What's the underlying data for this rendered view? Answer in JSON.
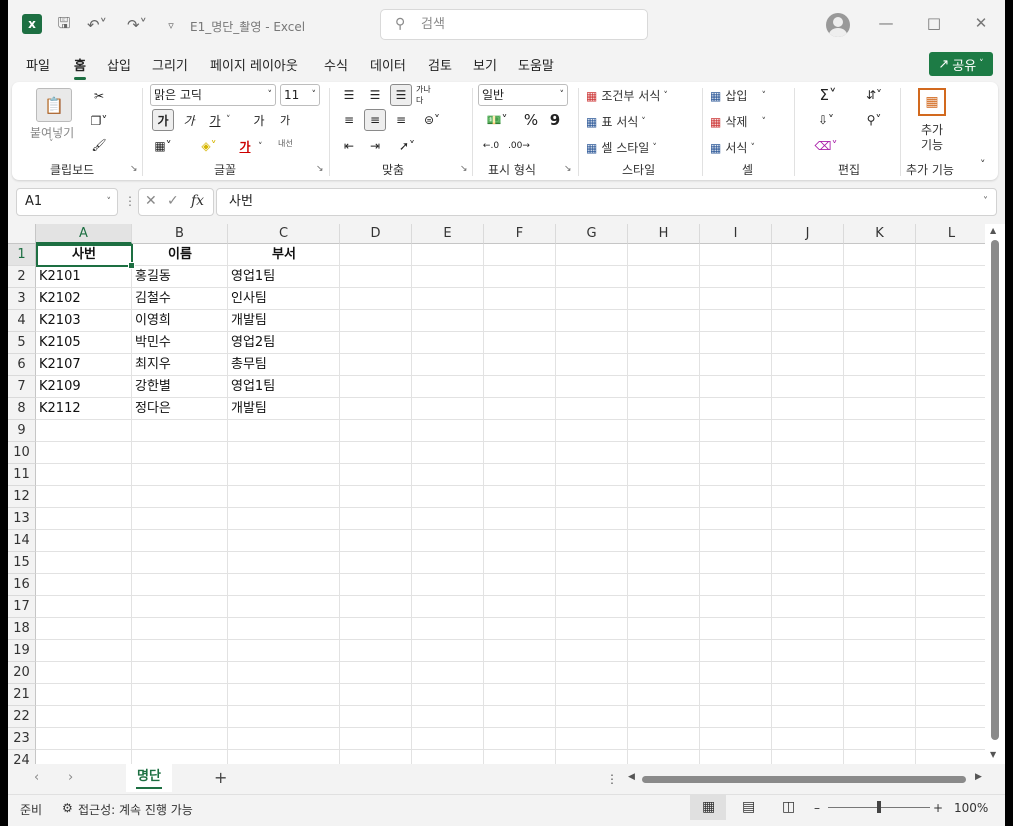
{
  "titlebar": {
    "doc_title": "E1_명단_촬영  -  Excel",
    "search_placeholder": "검색"
  },
  "menu": {
    "items": [
      "파일",
      "홈",
      "삽입",
      "그리기",
      "페이지 레이아웃",
      "수식",
      "데이터",
      "검토",
      "보기",
      "도움말"
    ],
    "active": "홈",
    "share_label": "공유"
  },
  "ribbon": {
    "clipboard": {
      "paste": "붙여넣기",
      "label": "클립보드"
    },
    "font": {
      "name": "맑은 고딕",
      "size": "11",
      "bold": "가",
      "italic": "가",
      "underline": "가",
      "grow": "가",
      "shrink": "가",
      "color_char": "가",
      "phonetic": "내선",
      "label": "글꼴"
    },
    "alignment": {
      "wrap": "가나다",
      "label": "맞춤"
    },
    "number": {
      "format": "일반",
      "percent": "%",
      "comma": "9",
      "label": "표시 형식"
    },
    "styles": {
      "conditional": "조건부 서식",
      "table": "표 서식",
      "cell_style": "셀 스타일",
      "label": "스타일"
    },
    "cells": {
      "insert": "삽입",
      "delete": "삭제",
      "format": "서식",
      "label": "셀"
    },
    "editing": {
      "label": "편집"
    },
    "addins": {
      "label_top": "추가",
      "label_bottom": "기능",
      "label": "추가 기능"
    }
  },
  "formula_bar": {
    "name_box": "A1",
    "fx": "fx",
    "content": "사번"
  },
  "sheet": {
    "columns": [
      "A",
      "B",
      "C",
      "D",
      "E",
      "F",
      "G",
      "H",
      "I",
      "J",
      "K",
      "L"
    ],
    "rows": [
      "1",
      "2",
      "3",
      "4",
      "5",
      "6",
      "7",
      "8",
      "9",
      "10",
      "11",
      "12",
      "13",
      "14",
      "15",
      "16",
      "17",
      "18",
      "19",
      "20",
      "21",
      "22",
      "23",
      "24"
    ],
    "headers": [
      "사번",
      "이름",
      "부서"
    ],
    "data": [
      [
        "K2101",
        "홍길동",
        "영업1팀"
      ],
      [
        "K2102",
        "김철수",
        "인사팀"
      ],
      [
        "K2103",
        "이영희",
        "개발팀"
      ],
      [
        "K2105",
        "박민수",
        "영업2팀"
      ],
      [
        "K2107",
        "최지우",
        "총무팀"
      ],
      [
        "K2109",
        "강한별",
        "영업1팀"
      ],
      [
        "K2112",
        "정다은",
        "개발팀"
      ]
    ]
  },
  "tabs": {
    "active": "명단",
    "add": "+"
  },
  "status": {
    "ready": "준비",
    "accessibility": "접근성: 계속 진행 가능",
    "zoom": "100%"
  }
}
